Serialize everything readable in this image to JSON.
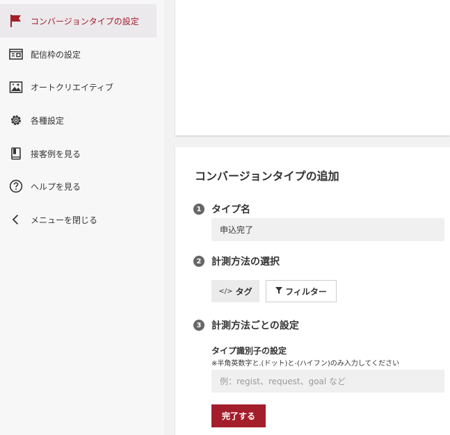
{
  "sidebar": {
    "items": [
      {
        "label": "コンバージョンタイプの設定",
        "icon": "flag-icon"
      },
      {
        "label": "配信枠の設定",
        "icon": "window-icon"
      },
      {
        "label": "オートクリエイティブ",
        "icon": "image-sparkle-icon"
      },
      {
        "label": "各種設定",
        "icon": "gear-icon"
      },
      {
        "label": "接客例を見る",
        "icon": "book-icon"
      },
      {
        "label": "ヘルプを見る",
        "icon": "help-circle-icon"
      },
      {
        "label": "メニューを閉じる",
        "icon": "chevron-left-icon"
      }
    ],
    "active_color": "#a31d2b"
  },
  "form": {
    "title": "コンバージョンタイプの追加",
    "step1": {
      "number": "1",
      "label": "タイプ名",
      "value": "申込完了"
    },
    "step2": {
      "number": "2",
      "label": "計測方法の選択",
      "tag_button": "タグ",
      "tag_icon_text": "</>",
      "filter_button": "フィルター"
    },
    "step3": {
      "number": "3",
      "label": "計測方法ごとの設定",
      "sub_heading": "タイプ識別子の設定",
      "note": "※半角英数字と.(ドット)と-(ハイフン)のみ入力してください",
      "placeholder": "例：regist、request、goal など"
    },
    "submit_label": "完了する",
    "accent_color": "#a31d2b"
  }
}
